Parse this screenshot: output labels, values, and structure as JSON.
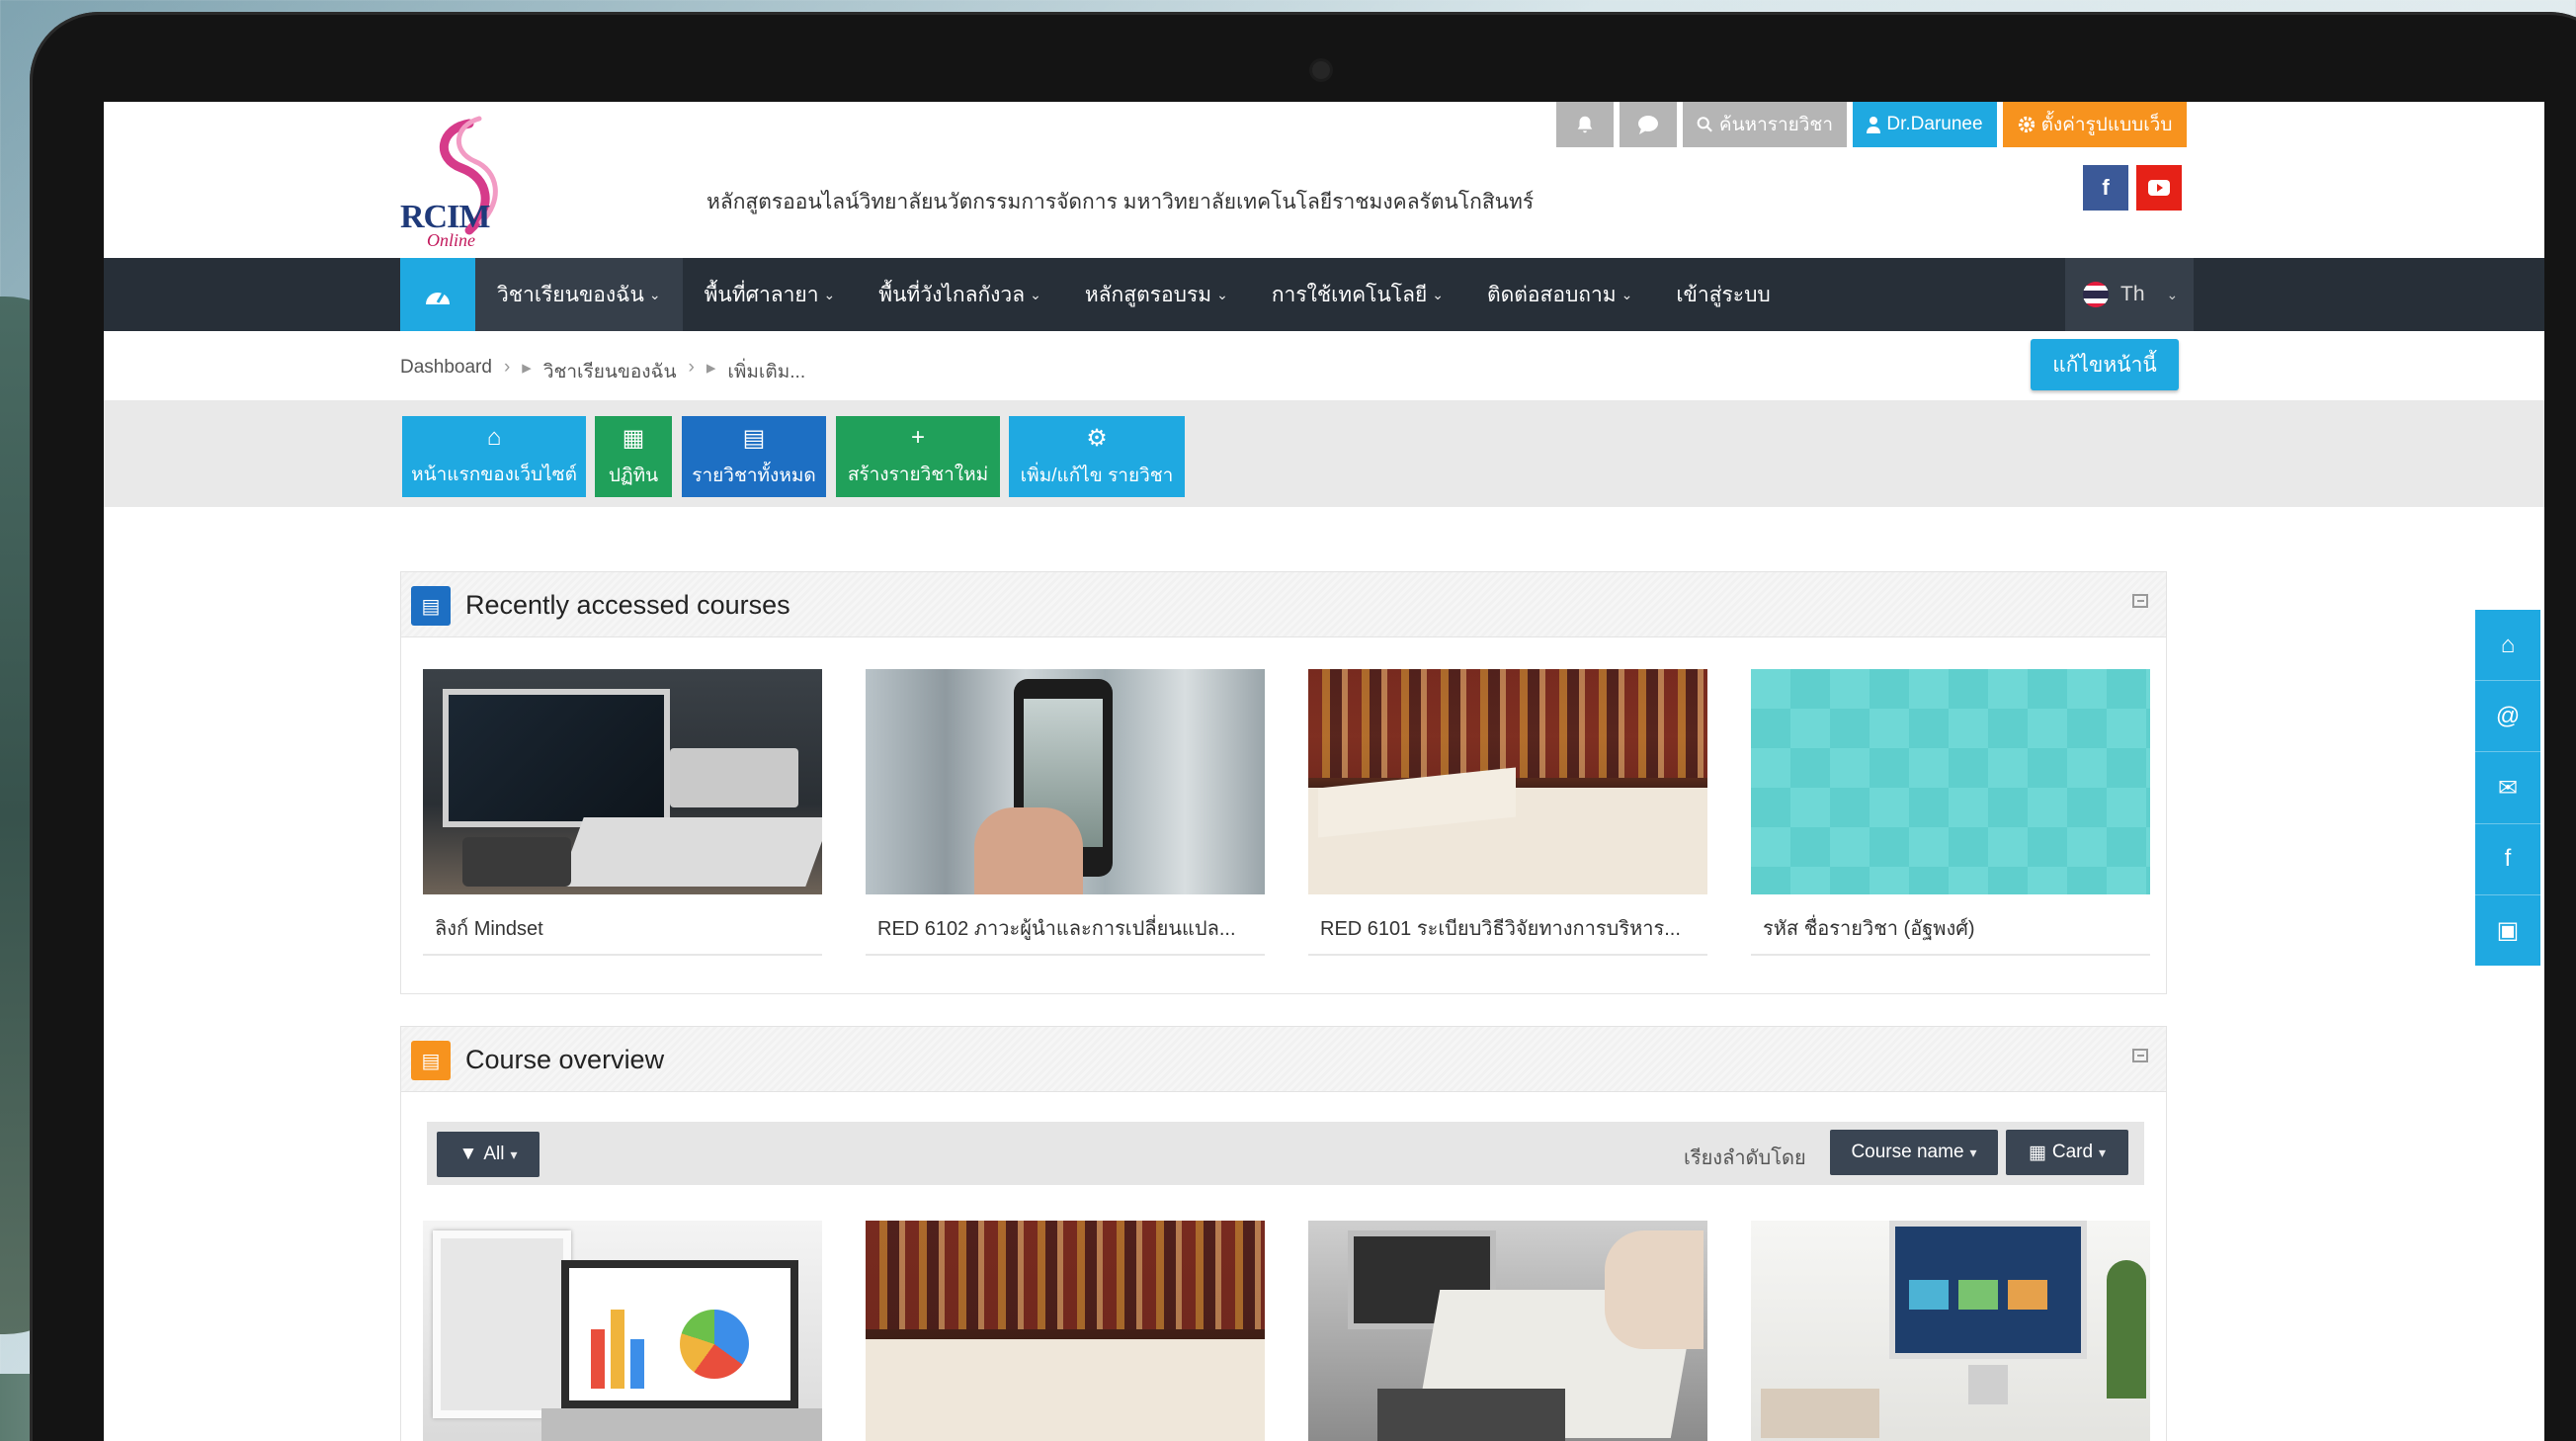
{
  "header": {
    "logo_text": "RCIM",
    "logo_sub": "Online",
    "site_title": "หลักสูตรออนไลน์วิทยาลัยนวัตกรรมการจัดการ   มหาวิทยาลัยเทคโนโลยีราชมงคลรัตนโกสินทร์",
    "search_label": "ค้นหารายวิชา",
    "user_label": "Dr.Darunee",
    "settings_label": "ตั้งค่ารูปแบบเว็บ",
    "facebook": "f"
  },
  "nav": {
    "items": [
      {
        "label": "วิชาเรียนของฉัน"
      },
      {
        "label": "พื้นที่ศาลายา"
      },
      {
        "label": "พื้นที่วังไกลกังวล"
      },
      {
        "label": "หลักสูตรอบรม"
      },
      {
        "label": "การใช้เทคโนโลยี"
      },
      {
        "label": "ติดต่อสอบถาม"
      }
    ],
    "login": "เข้าสู่ระบบ",
    "lang": "Th"
  },
  "breadcrumb": {
    "items": [
      "Dashboard",
      "วิชาเรียนของฉัน",
      "เพิ่มเติม..."
    ]
  },
  "edit_button": "แก้ไขหน้านี้",
  "quick_actions": [
    {
      "label": "หน้าแรกของเว็บไซต์"
    },
    {
      "label": "ปฏิทิน"
    },
    {
      "label": "รายวิชาทั้งหมด"
    },
    {
      "label": "สร้างรายวิชาใหม่"
    },
    {
      "label": "เพิ่ม/แก้ไข รายวิชา"
    }
  ],
  "recent": {
    "title": "Recently accessed courses",
    "cards": [
      {
        "label": "ลิงก์ Mindset"
      },
      {
        "label": "RED 6102 ภาวะผู้นำและการเปลี่ยนแปล..."
      },
      {
        "label": "RED 6101 ระเบียบวิธีวิจัยทางการบริหาร..."
      },
      {
        "label": "รหัส ชื่อรายวิชา (อัฐพงศ์)"
      }
    ]
  },
  "overview": {
    "title": "Course overview",
    "filter": "All",
    "sort_label": "เรียงลำดับโดย",
    "sort_value": "Course name",
    "view_value": "Card"
  },
  "colors": {
    "accent": "#1fa9e1",
    "navbar": "#272f38",
    "green": "#20a05a",
    "orange": "#f7931e"
  }
}
